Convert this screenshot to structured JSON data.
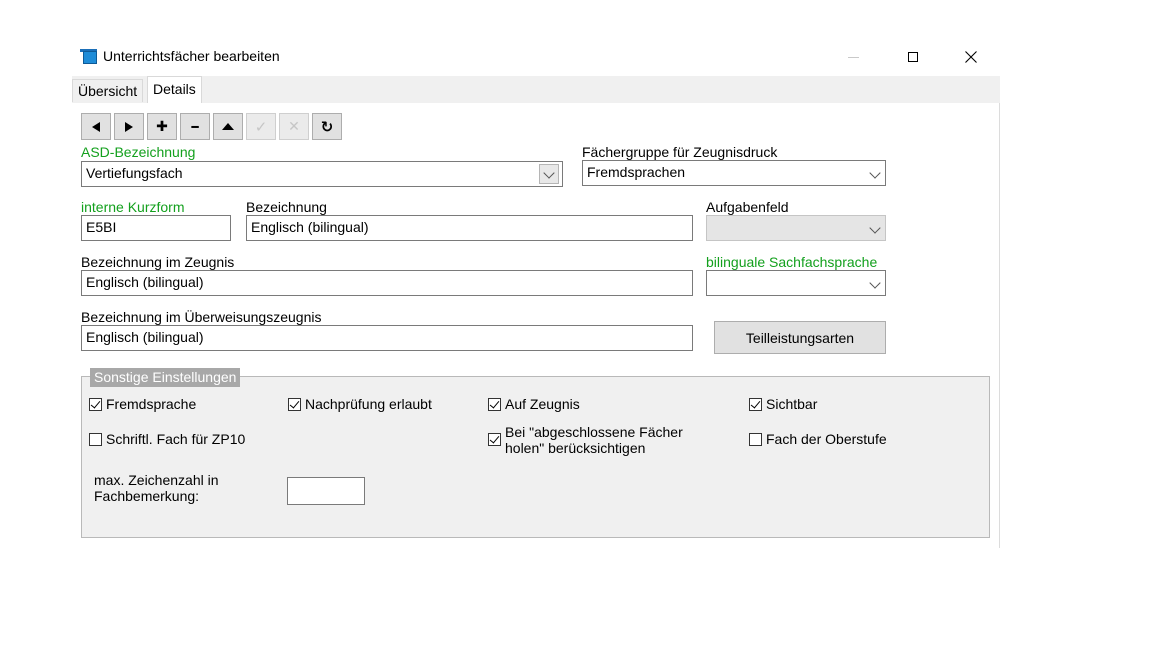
{
  "window": {
    "title": "Unterrichtsfächer bearbeiten"
  },
  "tabs": [
    {
      "label": "Übersicht",
      "active": false
    },
    {
      "label": "Details",
      "active": true
    }
  ],
  "toolbar": {
    "buttons": [
      {
        "name": "previous",
        "icon": "triangle-left-icon",
        "enabled": true
      },
      {
        "name": "next",
        "icon": "triangle-right-icon",
        "enabled": true
      },
      {
        "name": "add",
        "icon": "plus-icon",
        "glyph": "✚",
        "enabled": true
      },
      {
        "name": "remove",
        "icon": "minus-icon",
        "glyph": "━",
        "enabled": true
      },
      {
        "name": "first",
        "icon": "triangle-up-icon",
        "enabled": true
      },
      {
        "name": "confirm",
        "icon": "check-icon",
        "glyph": "✓",
        "enabled": false
      },
      {
        "name": "cancel",
        "icon": "x-icon",
        "glyph": "✕",
        "enabled": false
      },
      {
        "name": "refresh",
        "icon": "refresh-icon",
        "glyph": "↻",
        "enabled": true
      }
    ]
  },
  "form": {
    "asd_bezeichnung": {
      "label": "ASD-Bezeichnung",
      "value": "Vertiefungsfach"
    },
    "faechergruppe": {
      "label": "Fächergruppe für Zeugnisdruck",
      "value": "Fremdsprachen"
    },
    "interne_kurzform": {
      "label": "interne Kurzform",
      "value": "E5BI"
    },
    "bezeichnung": {
      "label": "Bezeichnung",
      "value": "Englisch (bilingual)"
    },
    "aufgabenfeld": {
      "label": "Aufgabenfeld",
      "value": ""
    },
    "bezeichnung_zeugnis": {
      "label": "Bezeichnung im Zeugnis",
      "value": "Englisch (bilingual)"
    },
    "bilinguale_sachfachsprache": {
      "label": "bilinguale Sachfachsprache",
      "value": ""
    },
    "bezeichnung_ueberweisung": {
      "label": "Bezeichnung im Überweisungszeugnis",
      "value": "Englisch (bilingual)"
    },
    "teilleistungsarten_label": "Teilleistungsarten"
  },
  "sonstige": {
    "title": "Sonstige Einstellungen",
    "checkboxes": {
      "fremdsprache": {
        "label": "Fremdsprache",
        "checked": true
      },
      "nachpruefung": {
        "label": "Nachprüfung erlaubt",
        "checked": true
      },
      "auf_zeugnis": {
        "label": "Auf Zeugnis",
        "checked": true
      },
      "sichtbar": {
        "label": "Sichtbar",
        "checked": true
      },
      "schriftl_zp10": {
        "label": "Schriftl. Fach für ZP10",
        "checked": false
      },
      "abgeschlossene_line1": "Bei \"abgeschlossene Fächer",
      "abgeschlossene_line2": "holen\" berücksichtigen",
      "abgeschlossene_checked": true,
      "oberstufe": {
        "label": "Fach der Oberstufe",
        "checked": false
      }
    },
    "max_zeichen_line1": "max. Zeichenzahl in",
    "max_zeichen_line2": "Fachbemerkung:",
    "max_zeichen_value": ""
  },
  "colors": {
    "green_label": "#13a01d",
    "group_title_bg": "#a8a8a8",
    "group_bg": "#f0f0f0"
  }
}
